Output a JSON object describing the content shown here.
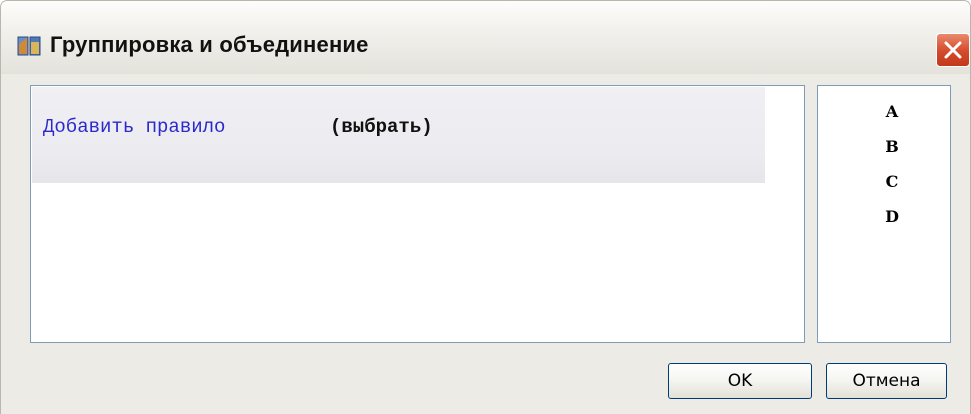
{
  "window": {
    "title": "Группировка и объединение",
    "icon": "app-icon",
    "close_icon": "close-icon"
  },
  "rules": {
    "add_rule_link": "Добавить правило",
    "select_placeholder": "(выбрать)"
  },
  "fields": {
    "items": [
      "A",
      "B",
      "C",
      "D"
    ]
  },
  "buttons": {
    "ok_label": "OK",
    "cancel_label": "Отмена"
  },
  "colors": {
    "link": "#2a2acc",
    "close_button": "#d34a2b",
    "panel_border": "#7f9db9",
    "button_border": "#003c74"
  }
}
